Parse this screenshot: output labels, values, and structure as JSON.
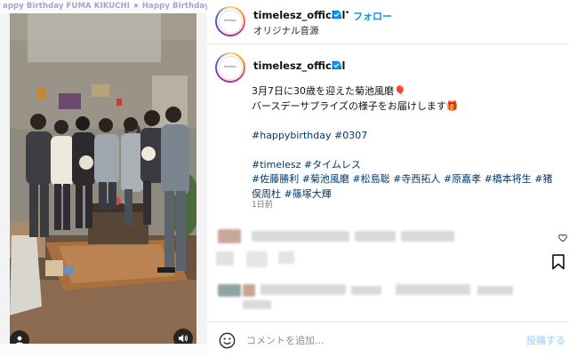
{
  "media": {
    "marquee_text": "appy Birthday FUMA KIKUCHI ★ Happy Birthday FUMA KIKUCHI ★ Happy Birthday FUMA KIKU"
  },
  "header": {
    "username": "timelesz_official",
    "follow_label": "フォロー",
    "audio_label": "オリジナル音源",
    "logo_text": "timelesz"
  },
  "post": {
    "username": "timelesz_official",
    "caption_lines": [
      "3月7日に30歳を迎えた菊池風磨🎈",
      "バースデーサプライズの様子をお届けします🎁"
    ],
    "hashtags_line1": "#happybirthday #0307",
    "hashtags_line2": "#timelesz #タイムレス",
    "hashtags_line3": "#佐藤勝利 #菊池風磨 #松島聡 #寺西拓人 #原嘉孝 #橋本将生 #猪",
    "hashtags_line4": "俣周杜 #篠塚大輝",
    "time_ago": "1日前"
  },
  "comment": {
    "placeholder": "コメントを追加...",
    "post_label": "投稿する"
  },
  "colors": {
    "accent": "#0095f6",
    "hashtag": "#00376b",
    "post_disabled": "#b8dcfb"
  },
  "icons": {
    "verified": "verified-badge-icon",
    "user": "user-tag-icon",
    "volume": "volume-icon",
    "heart": "heart-icon",
    "bookmark": "bookmark-icon",
    "emoji": "emoji-icon"
  }
}
